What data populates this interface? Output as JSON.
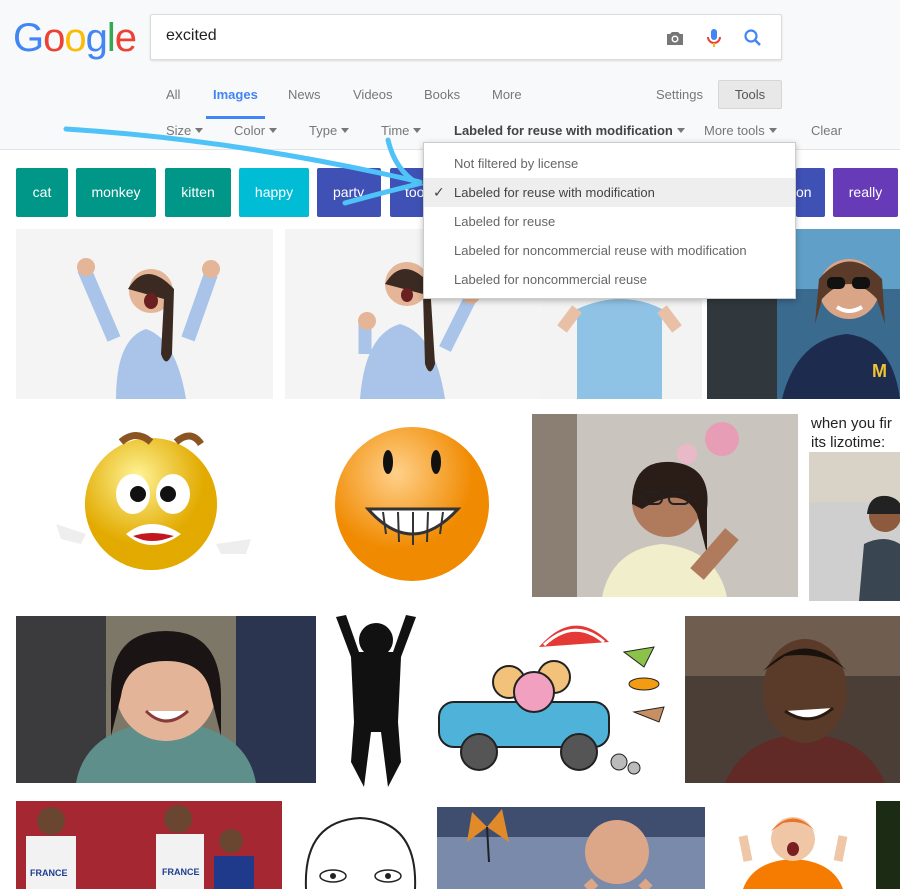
{
  "logo": {
    "letters": [
      "G",
      "o",
      "o",
      "g",
      "l",
      "e"
    ],
    "colors": [
      "#4285f4",
      "#ea4335",
      "#fbbc05",
      "#4285f4",
      "#34a853",
      "#ea4335"
    ]
  },
  "search": {
    "query": "excited",
    "icons": [
      "camera-icon",
      "mic-icon",
      "search-icon"
    ]
  },
  "nav": {
    "tabs": [
      "All",
      "Images",
      "News",
      "Videos",
      "Books",
      "More"
    ],
    "active": "Images",
    "settings": "Settings",
    "tools": "Tools"
  },
  "filters": {
    "size": "Size",
    "color": "Color",
    "type": "Type",
    "time": "Time",
    "license": "Labeled for reuse with modification",
    "more_tools": "More tools",
    "clear": "Clear"
  },
  "chips": [
    "cat",
    "monkey",
    "kitten",
    "happy",
    "party",
    "too",
    "on",
    "really"
  ],
  "chip_colors": [
    "#009688",
    "#009688",
    "#009688",
    "#00bcd4",
    "#3f51b5",
    "#3f51b5",
    "#3f51b5",
    "#673ab7"
  ],
  "dropdown": {
    "items": [
      "Not filtered by license",
      "Labeled for reuse with modification",
      "Labeled for reuse",
      "Labeled for noncommercial reuse with modification",
      "Labeled for noncommercial reuse"
    ],
    "selected_index": 1
  },
  "image_caption": {
    "line1": "when you fir",
    "line2": "its lizotime:"
  }
}
